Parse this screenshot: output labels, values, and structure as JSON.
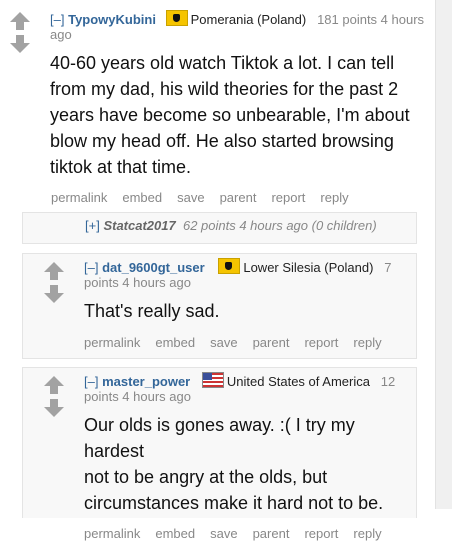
{
  "comments": [
    {
      "collapse": "[–]",
      "author": "TypowyKubini",
      "flair": "Pomerania (Poland)",
      "points_time": "181 points 4 hours",
      "points_time_cont": "ago",
      "body": [
        "40-60 years old watch Tiktok a lot. I can tell",
        "from my dad, his wild theories for the past 2",
        "years have become so unbearable, I'm about",
        "blow my head off. He also started browsing",
        "tiktok at that time."
      ],
      "flair_icon": "pomerania-griffin-flag"
    },
    {
      "collapse": "[–]",
      "author": "dat_9600gt_user",
      "flair": "Lower Silesia (Poland)",
      "points_time": "7",
      "points_time_cont": "points 4 hours ago",
      "body": [
        "That's really sad."
      ],
      "flair_icon": "lower-silesia-flag"
    },
    {
      "collapse": "[–]",
      "author": "master_power",
      "flair": "United States of America",
      "points_time": "12",
      "points_time_cont": "points 4 hours ago",
      "body": [
        "Our olds is gones away. :( I try my hardest",
        "not to be angry at the olds, but",
        "circumstances make it hard not to be."
      ],
      "flair_icon": "usa-flag"
    }
  ],
  "collapsed": {
    "expand": "[+]",
    "author": "Statcat2017",
    "meta": "62 points 4 hours ago (0 children)"
  },
  "buttons": [
    "permalink",
    "embed",
    "save",
    "parent",
    "report",
    "reply"
  ]
}
